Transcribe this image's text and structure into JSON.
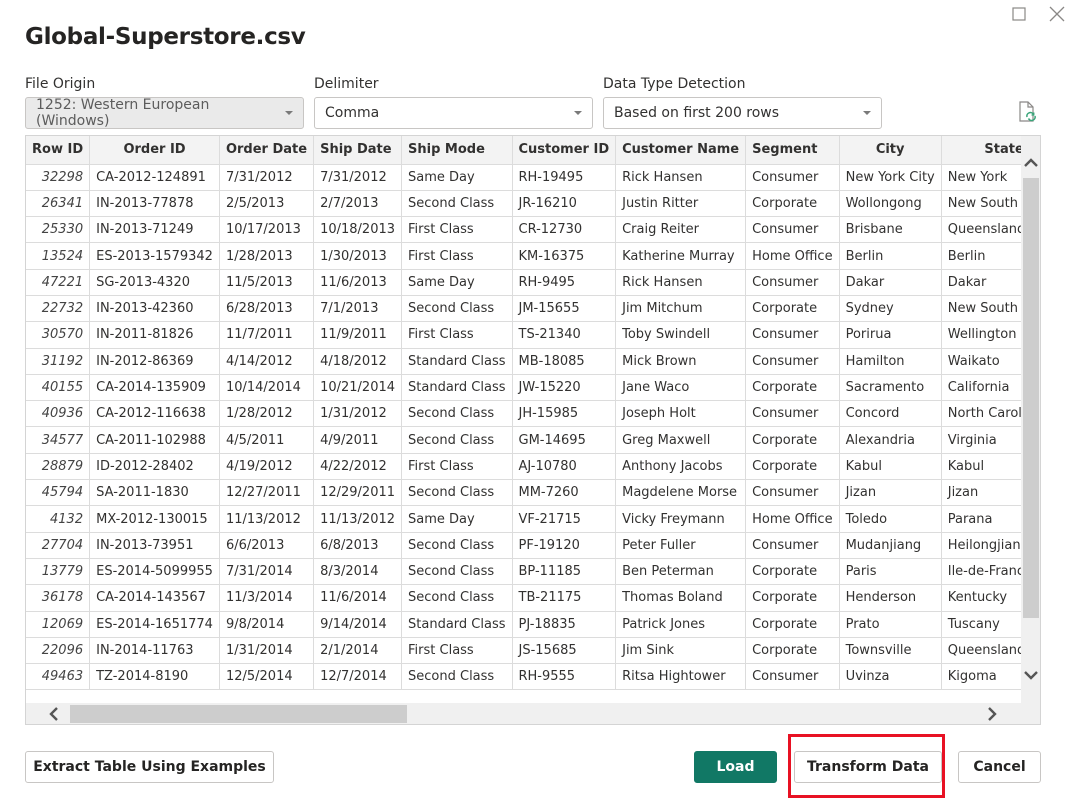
{
  "window": {
    "title": "Global-Superstore.csv",
    "maximize_icon": "maximize-icon",
    "close_icon": "close-icon"
  },
  "options": {
    "file_origin": {
      "label": "File Origin",
      "value": "1252: Western European (Windows)",
      "disabled": true
    },
    "delimiter": {
      "label": "Delimiter",
      "value": "Comma"
    },
    "data_type_detection": {
      "label": "Data Type Detection",
      "value": "Based on first 200 rows"
    },
    "refresh_icon": "document-refresh-icon"
  },
  "table": {
    "columns": [
      "Row ID",
      "Order ID",
      "Order Date",
      "Ship Date",
      "Ship Mode",
      "Customer ID",
      "Customer Name",
      "Segment",
      "City",
      "State"
    ],
    "rows": [
      [
        "32298",
        "CA-2012-124891",
        "7/31/2012",
        "7/31/2012",
        "Same Day",
        "RH-19495",
        "Rick Hansen",
        "Consumer",
        "New York City",
        "New York"
      ],
      [
        "26341",
        "IN-2013-77878",
        "2/5/2013",
        "2/7/2013",
        "Second Class",
        "JR-16210",
        "Justin Ritter",
        "Corporate",
        "Wollongong",
        "New South Wales"
      ],
      [
        "25330",
        "IN-2013-71249",
        "10/17/2013",
        "10/18/2013",
        "First Class",
        "CR-12730",
        "Craig Reiter",
        "Consumer",
        "Brisbane",
        "Queensland"
      ],
      [
        "13524",
        "ES-2013-1579342",
        "1/28/2013",
        "1/30/2013",
        "First Class",
        "KM-16375",
        "Katherine Murray",
        "Home Office",
        "Berlin",
        "Berlin"
      ],
      [
        "47221",
        "SG-2013-4320",
        "11/5/2013",
        "11/6/2013",
        "Same Day",
        "RH-9495",
        "Rick Hansen",
        "Consumer",
        "Dakar",
        "Dakar"
      ],
      [
        "22732",
        "IN-2013-42360",
        "6/28/2013",
        "7/1/2013",
        "Second Class",
        "JM-15655",
        "Jim Mitchum",
        "Corporate",
        "Sydney",
        "New South Wales"
      ],
      [
        "30570",
        "IN-2011-81826",
        "11/7/2011",
        "11/9/2011",
        "First Class",
        "TS-21340",
        "Toby Swindell",
        "Consumer",
        "Porirua",
        "Wellington"
      ],
      [
        "31192",
        "IN-2012-86369",
        "4/14/2012",
        "4/18/2012",
        "Standard Class",
        "MB-18085",
        "Mick Brown",
        "Consumer",
        "Hamilton",
        "Waikato"
      ],
      [
        "40155",
        "CA-2014-135909",
        "10/14/2014",
        "10/21/2014",
        "Standard Class",
        "JW-15220",
        "Jane Waco",
        "Corporate",
        "Sacramento",
        "California"
      ],
      [
        "40936",
        "CA-2012-116638",
        "1/28/2012",
        "1/31/2012",
        "Second Class",
        "JH-15985",
        "Joseph Holt",
        "Consumer",
        "Concord",
        "North Carolina"
      ],
      [
        "34577",
        "CA-2011-102988",
        "4/5/2011",
        "4/9/2011",
        "Second Class",
        "GM-14695",
        "Greg Maxwell",
        "Corporate",
        "Alexandria",
        "Virginia"
      ],
      [
        "28879",
        "ID-2012-28402",
        "4/19/2012",
        "4/22/2012",
        "First Class",
        "AJ-10780",
        "Anthony Jacobs",
        "Corporate",
        "Kabul",
        "Kabul"
      ],
      [
        "45794",
        "SA-2011-1830",
        "12/27/2011",
        "12/29/2011",
        "Second Class",
        "MM-7260",
        "Magdelene Morse",
        "Consumer",
        "Jizan",
        "Jizan"
      ],
      [
        "4132",
        "MX-2012-130015",
        "11/13/2012",
        "11/13/2012",
        "Same Day",
        "VF-21715",
        "Vicky Freymann",
        "Home Office",
        "Toledo",
        "Parana"
      ],
      [
        "27704",
        "IN-2013-73951",
        "6/6/2013",
        "6/8/2013",
        "Second Class",
        "PF-19120",
        "Peter Fuller",
        "Consumer",
        "Mudanjiang",
        "Heilongjiang"
      ],
      [
        "13779",
        "ES-2014-5099955",
        "7/31/2014",
        "8/3/2014",
        "Second Class",
        "BP-11185",
        "Ben Peterman",
        "Corporate",
        "Paris",
        "Ile-de-France"
      ],
      [
        "36178",
        "CA-2014-143567",
        "11/3/2014",
        "11/6/2014",
        "Second Class",
        "TB-21175",
        "Thomas Boland",
        "Corporate",
        "Henderson",
        "Kentucky"
      ],
      [
        "12069",
        "ES-2014-1651774",
        "9/8/2014",
        "9/14/2014",
        "Standard Class",
        "PJ-18835",
        "Patrick Jones",
        "Corporate",
        "Prato",
        "Tuscany"
      ],
      [
        "22096",
        "IN-2014-11763",
        "1/31/2014",
        "2/1/2014",
        "First Class",
        "JS-15685",
        "Jim Sink",
        "Corporate",
        "Townsville",
        "Queensland"
      ],
      [
        "49463",
        "TZ-2014-8190",
        "12/5/2014",
        "12/7/2014",
        "Second Class",
        "RH-9555",
        "Ritsa Hightower",
        "Consumer",
        "Uvinza",
        "Kigoma"
      ]
    ]
  },
  "footer": {
    "extract_label": "Extract Table Using Examples",
    "load_label": "Load",
    "transform_label": "Transform Data",
    "cancel_label": "Cancel"
  },
  "colors": {
    "primary": "#117865",
    "highlight": "#e81123"
  }
}
